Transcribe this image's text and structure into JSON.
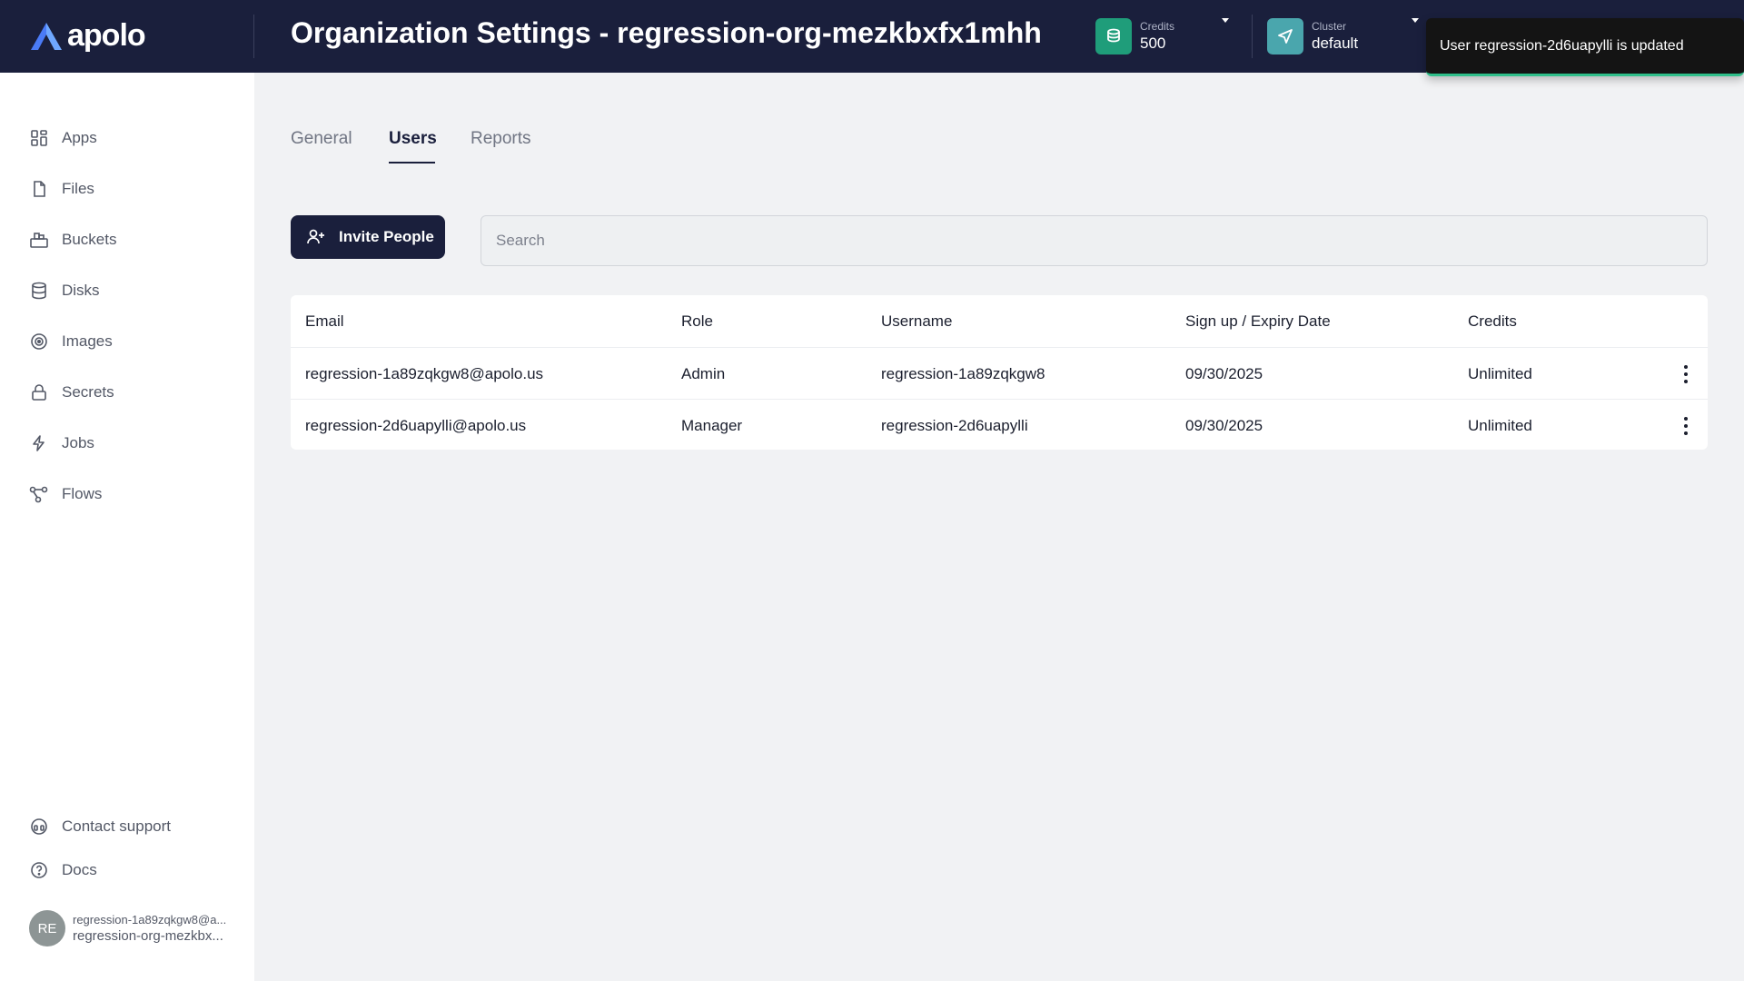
{
  "brand": {
    "name": "apolo"
  },
  "header": {
    "title": "Organization Settings - regression-org-mezkbxfx1mhh",
    "credits": {
      "label": "Credits",
      "value": "500"
    },
    "cluster": {
      "label": "Cluster",
      "value": "default"
    }
  },
  "toast": {
    "message": "User regression-2d6uapylli is updated"
  },
  "sidebar": {
    "items": [
      {
        "label": "Apps",
        "icon": "apps-grid-icon"
      },
      {
        "label": "Files",
        "icon": "file-icon"
      },
      {
        "label": "Buckets",
        "icon": "bucket-icon"
      },
      {
        "label": "Disks",
        "icon": "database-icon"
      },
      {
        "label": "Images",
        "icon": "disc-icon"
      },
      {
        "label": "Secrets",
        "icon": "lock-icon"
      },
      {
        "label": "Jobs",
        "icon": "lightning-icon"
      },
      {
        "label": "Flows",
        "icon": "flow-icon"
      }
    ],
    "bottom": [
      {
        "label": "Contact support",
        "icon": "headset-icon"
      },
      {
        "label": "Docs",
        "icon": "question-circle-icon"
      }
    ],
    "user": {
      "initials": "RE",
      "email": "regression-1a89zqkgw8@a...",
      "org": "regression-org-mezkbx..."
    }
  },
  "tabs": [
    {
      "label": "General",
      "active": false
    },
    {
      "label": "Users",
      "active": true
    },
    {
      "label": "Reports",
      "active": false
    }
  ],
  "invite_button": {
    "label": "Invite People"
  },
  "search": {
    "placeholder": "Search",
    "value": ""
  },
  "table": {
    "columns": [
      "Email",
      "Role",
      "Username",
      "Sign up / Expiry Date",
      "Credits"
    ],
    "rows": [
      {
        "email": "regression-1a89zqkgw8@apolo.us",
        "role": "Admin",
        "username": "regression-1a89zqkgw8",
        "date": "09/30/2025",
        "credits": "Unlimited"
      },
      {
        "email": "regression-2d6uapylli@apolo.us",
        "role": "Manager",
        "username": "regression-2d6uapylli",
        "date": "09/30/2025",
        "credits": "Unlimited"
      }
    ]
  },
  "colors": {
    "header_bg": "#1a1f3c",
    "credits_chip": "#1f9d7a",
    "cluster_chip": "#4aa6ad",
    "toast_accent": "#2fbf8a",
    "logo_accent": "#4a7bf7"
  }
}
